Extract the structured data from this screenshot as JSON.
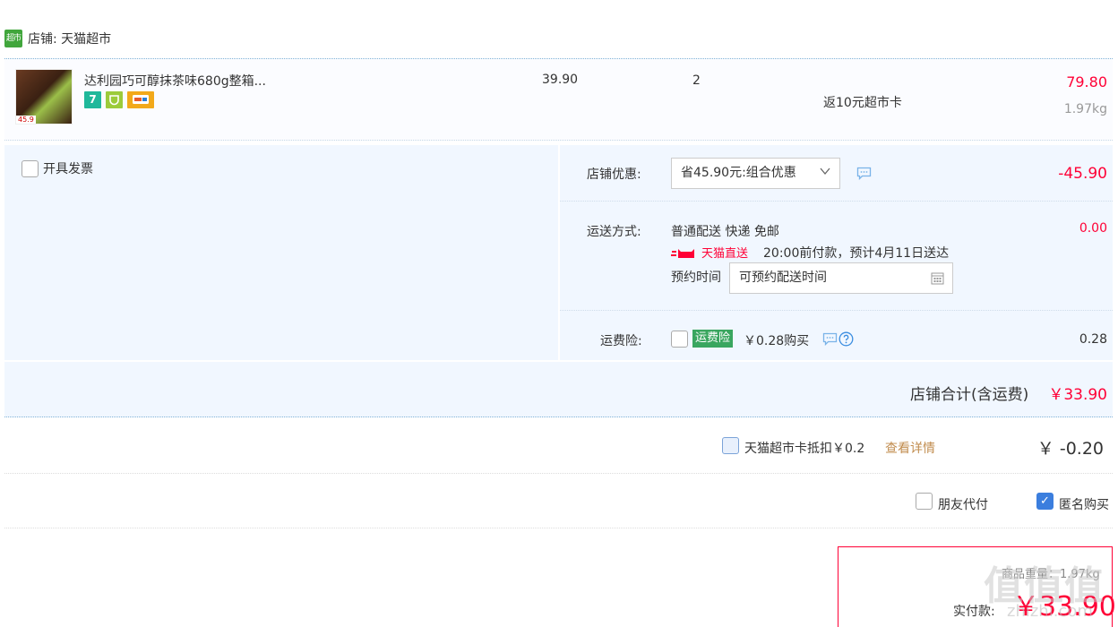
{
  "shop": {
    "logo_text": "超市",
    "label": "店铺: 天猫超市"
  },
  "item": {
    "thumb_tag": "",
    "thumb_price": "45.9",
    "title": "达利园巧可醇抹茶味680g整箱...",
    "badge_seven": "7",
    "unit_price": "39.90",
    "quantity": "2",
    "rebate": "返10元超市卡",
    "subtotal": "79.80",
    "weight": "1.97kg"
  },
  "invoice": {
    "label": "开具发票"
  },
  "shop_discount": {
    "label": "店铺优惠:",
    "selected": "省45.90元:组合优惠",
    "value": "-45.90"
  },
  "shipping": {
    "label": "运送方式:",
    "method": "普通配送 快递 免邮",
    "direct": "天猫直送",
    "eta": "20:00前付款，预计4月11日送达",
    "appt_label": "预约时间",
    "appt_placeholder": "可预约配送时间",
    "fee": "0.00"
  },
  "insurance": {
    "label": "运费险:",
    "tag": "运费险",
    "price": "￥0.28购买",
    "fee": "0.28"
  },
  "shop_total": {
    "label": "店铺合计(含运费)",
    "value": "￥33.90"
  },
  "card": {
    "text": "天猫超市卡抵扣￥0.2",
    "link": "查看详情",
    "value": "￥ -0.20"
  },
  "options": {
    "friend_pay": "朋友代付",
    "anonymous": "匿名购买"
  },
  "payment": {
    "weight_label": "商品重量：1.97kg",
    "label": "实付款:",
    "amount": "￥33.90"
  },
  "watermark": {
    "main": "值值值",
    "sub": "zhizhi.com"
  },
  "colors": {
    "price_red": "#ff0036",
    "panel_blue": "#f1f7ff",
    "tmall_green": "#41a63c",
    "link_gold": "#c18c4e"
  }
}
